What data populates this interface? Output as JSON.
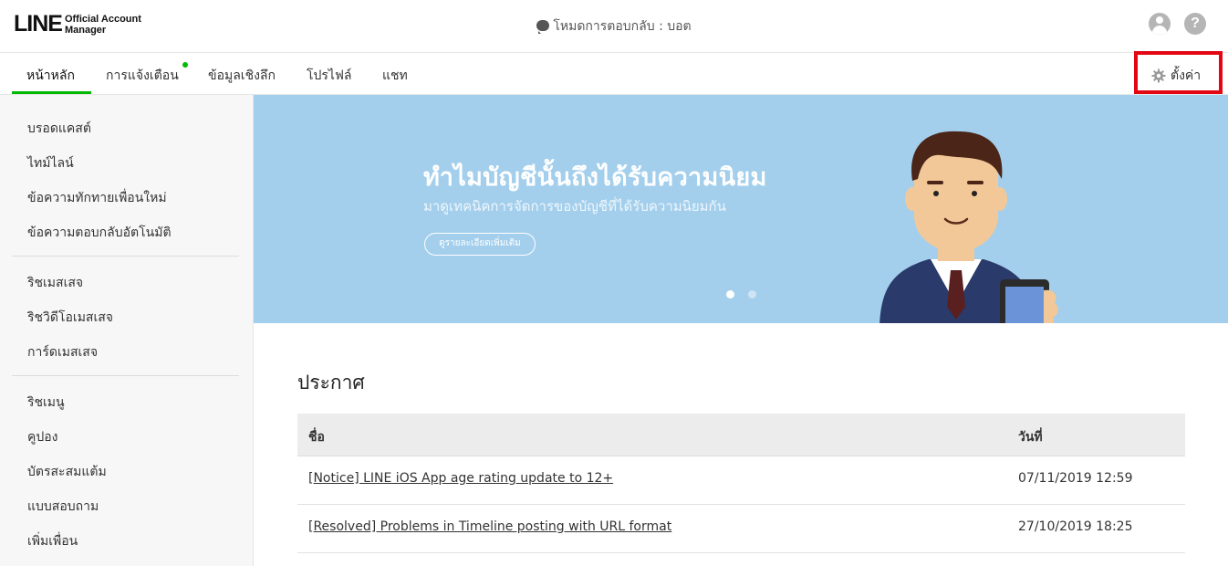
{
  "header": {
    "logo_main": "LINE",
    "logo_sub_1": "Official Account",
    "logo_sub_2": "Manager",
    "mode_text": "โหมดการตอบกลับ : บอต",
    "help_glyph": "?"
  },
  "nav": {
    "tabs": [
      {
        "label": "หน้าหลัก",
        "active": true
      },
      {
        "label": "การแจ้งเตือน",
        "has_dot": true
      },
      {
        "label": "ข้อมูลเชิงลึก"
      },
      {
        "label": "โปรไฟล์"
      },
      {
        "label": "แชท"
      }
    ],
    "settings_label": "ตั้งค่า",
    "accent": "#00b900",
    "highlight": "#e30613"
  },
  "sidebar": {
    "groups": [
      [
        "บรอดแคสต์",
        "ไทม์ไลน์",
        "ข้อความทักทายเพื่อนใหม่",
        "ข้อความตอบกลับอัตโนมัติ"
      ],
      [
        "ริชเมสเสจ",
        "ริชวิดีโอเมสเสจ",
        "การ์ดเมสเสจ"
      ],
      [
        "ริชเมนู",
        "คูปอง",
        "บัตรสะสมแต้ม",
        "แบบสอบถาม",
        "เพิ่มเพื่อน"
      ]
    ]
  },
  "banner": {
    "title": "ทำไมบัญชีนั้นถึงได้รับความนิยม",
    "subtitle": "มาดูเทคนิคการจัดการของบัญชีที่ได้รับความนิยมกัน",
    "button_label": "ดูรายละเอียดเพิ่มเติม",
    "background": "#a3cfec",
    "slides": 2,
    "active_slide": 1
  },
  "announcements": {
    "title": "ประกาศ",
    "columns": [
      "ชื่อ",
      "วันที่"
    ],
    "rows": [
      {
        "name": "[Notice] LINE iOS App age rating update to 12+",
        "date": "07/11/2019 12:59"
      },
      {
        "name": "[Resolved] Problems in Timeline posting with URL format",
        "date": "27/10/2019 18:25"
      }
    ]
  }
}
